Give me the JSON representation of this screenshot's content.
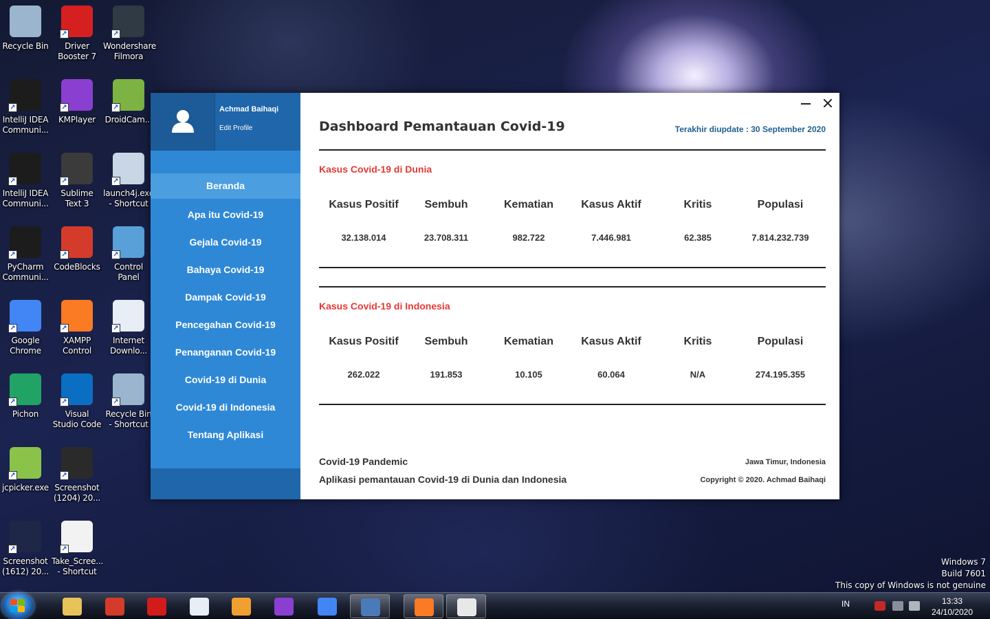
{
  "desktop": {
    "icons": [
      {
        "label": "Recycle Bin",
        "icon": "recycle-bin-icon",
        "color": "#9bb5cf"
      },
      {
        "label": "Driver Booster 7",
        "icon": "driver-booster-icon",
        "color": "#d62020"
      },
      {
        "label": "Wondershare Filmora",
        "icon": "filmora-icon",
        "color": "#2f3a44"
      },
      {
        "label": "IntelliJ IDEA Communi...",
        "icon": "intellij-icon",
        "color": "#1c1c1c"
      },
      {
        "label": "KMPlayer",
        "icon": "kmplayer-icon",
        "color": "#8a3fd1"
      },
      {
        "label": "DroidCam...",
        "icon": "droidcam-icon",
        "color": "#7cb342"
      },
      {
        "label": "IntelliJ IDEA Communi...",
        "icon": "intellij-icon",
        "color": "#1c1c1c"
      },
      {
        "label": "Sublime Text 3",
        "icon": "sublime-text-icon",
        "color": "#3b3b3b"
      },
      {
        "label": "launch4j.exe - Shortcut",
        "icon": "launch4j-icon",
        "color": "#c8d6e5"
      },
      {
        "label": "PyCharm Communi...",
        "icon": "pycharm-icon",
        "color": "#1c1c1c"
      },
      {
        "label": "CodeBlocks",
        "icon": "codeblocks-icon",
        "color": "#d43b2a"
      },
      {
        "label": "Control Panel",
        "icon": "control-panel-icon",
        "color": "#5aa0d8"
      },
      {
        "label": "Google Chrome",
        "icon": "chrome-icon",
        "color": "#4285f4"
      },
      {
        "label": "XAMPP Control",
        "icon": "xampp-icon",
        "color": "#fb7a24"
      },
      {
        "label": "Internet Downlo...",
        "icon": "internet-download-icon",
        "color": "#e8eef5"
      },
      {
        "label": "Pichon",
        "icon": "pichon-icon",
        "color": "#21a366"
      },
      {
        "label": "Visual Studio Code",
        "icon": "vscode-icon",
        "color": "#0a6fc2"
      },
      {
        "label": "Recycle Bin - Shortcut",
        "icon": "recycle-bin-icon",
        "color": "#9bb5cf"
      },
      {
        "label": "jcpicker.exe",
        "icon": "jcpicker-icon",
        "color": "#8bc34a"
      },
      {
        "label": "Screenshot (1204) 20...",
        "icon": "image-file-icon",
        "color": "#2a2a2a"
      },
      {
        "label": "",
        "icon": "",
        "color": ""
      },
      {
        "label": "Screenshot (1612) 20...",
        "icon": "image-file-icon",
        "color": "#1e2748"
      },
      {
        "label": "Take_Scree... - Shortcut",
        "icon": "java-file-icon",
        "color": "#f2f2f2"
      }
    ]
  },
  "app": {
    "profile": {
      "name": "Achmad Baihaqi",
      "edit": "Edit Profile"
    },
    "nav": [
      "Beranda",
      "Apa itu Covid-19",
      "Gejala Covid-19",
      "Bahaya Covid-19",
      "Dampak Covid-19",
      "Pencegahan Covid-19",
      "Penanganan Covid-19",
      "Covid-19 di Dunia",
      "Covid-19 di Indonesia",
      "Tentang Aplikasi"
    ],
    "title": "Dashboard Pemantauan Covid-19",
    "updated": "Terakhir diupdate : 30 September 2020",
    "headers": [
      "Kasus Positif",
      "Sembuh",
      "Kematian",
      "Kasus Aktif",
      "Kritis",
      "Populasi"
    ],
    "world": {
      "title": "Kasus Covid-19 di Dunia",
      "values": [
        "32.138.014",
        "23.708.311",
        "982.722",
        "7.446.981",
        "62.385",
        "7.814.232.739"
      ]
    },
    "indonesia": {
      "title": "Kasus Covid-19 di Indonesia",
      "values": [
        "262.022",
        "191.853",
        "10.105",
        "60.064",
        "N/A",
        "274.195.355"
      ]
    },
    "footer": {
      "left1": "Covid-19 Pandemic",
      "left2": "Aplikasi pemantauan Covid-19 di Dunia dan Indonesia",
      "right1": "Jawa Timur, Indonesia",
      "right2": "Copyright © 2020. Achmad Baihaqi"
    },
    "colors": {
      "sidebar": "#2e88d6",
      "sidebar_dark": "#1f66aa",
      "accent_red": "#e53935",
      "updated": "#1f5f8f"
    }
  },
  "watermark": [
    "Windows 7",
    "Build 7601",
    "This copy of Windows is not genuine"
  ],
  "taskbar": {
    "apps": [
      {
        "icon": "windows-explorer-icon",
        "color": "#e8c25a",
        "open": false
      },
      {
        "icon": "codeblocks-icon",
        "color": "#d43b2a",
        "open": false
      },
      {
        "icon": "pdf-reader-icon",
        "color": "#d21c1c",
        "open": false
      },
      {
        "icon": "notepad-icon",
        "color": "#e8eef5",
        "open": false
      },
      {
        "icon": "media-player-icon",
        "color": "#f0a030",
        "open": false
      },
      {
        "icon": "kmplayer-icon",
        "color": "#8a3fd1",
        "open": false
      },
      {
        "icon": "chrome-icon",
        "color": "#4285f4",
        "open": false
      },
      {
        "icon": "virtualbox-icon",
        "color": "#4a7ab8",
        "open": true
      },
      {
        "icon": "xampp-icon",
        "color": "#fb7a24",
        "open": true
      },
      {
        "icon": "java-icon",
        "color": "#e8e8e8",
        "open": true
      }
    ],
    "lang": "IN",
    "time": "13:33",
    "date": "24/10/2020"
  }
}
